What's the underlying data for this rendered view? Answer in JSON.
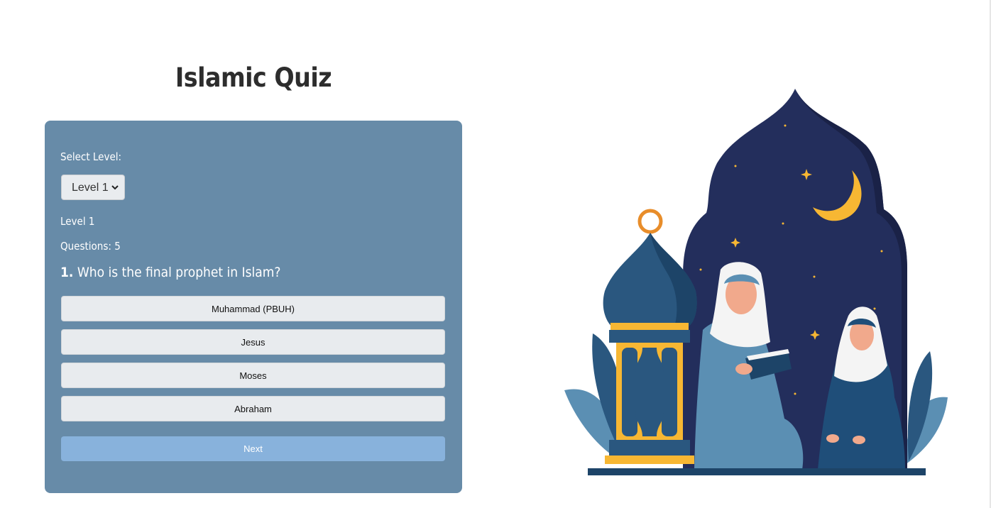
{
  "app": {
    "title": "Islamic Quiz"
  },
  "quiz": {
    "select_label": "Select Level:",
    "selected_level": "Level 1",
    "level_text": "Level 1",
    "questions_text": "Questions: 5",
    "question_number": "1.",
    "question_text": "Who is the final prophet in Islam?",
    "answers": [
      "Muhammad (PBUH)",
      "Jesus",
      "Moses",
      "Abraham"
    ],
    "next_label": "Next"
  },
  "colors": {
    "card_bg": "#678ba8",
    "next_button": "#88b2dc",
    "answer_bg": "#e8ebee",
    "title": "#2d2d2d",
    "night_sky": "#232e5c",
    "lantern_gold": "#f7b733"
  },
  "illustration": {
    "description_icon": "mosque-arch-with-women-reading-quran-icon"
  }
}
